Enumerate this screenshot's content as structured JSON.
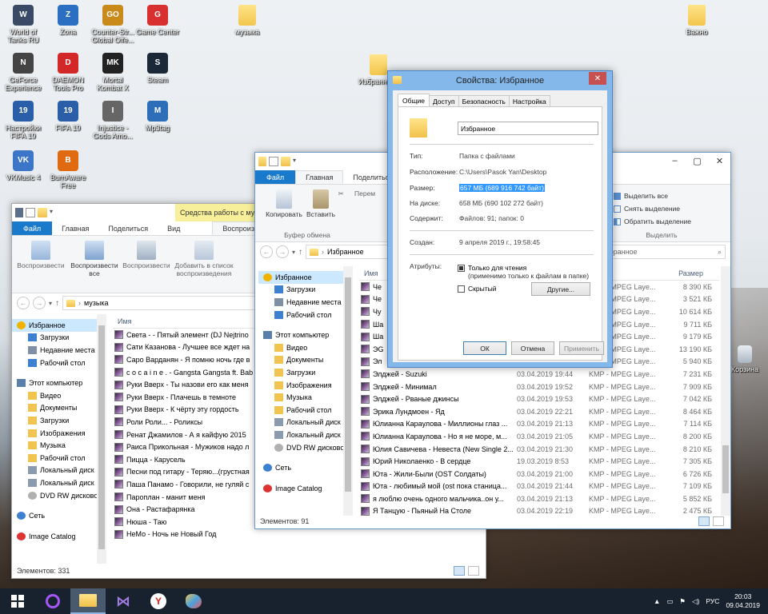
{
  "desktop": {
    "icons": [
      {
        "label": "World of\nTanks RU",
        "icon": "wot-icon",
        "color": "#3a4a66",
        "glyph": "W"
      },
      {
        "label": "Zona",
        "icon": "zona-icon",
        "color": "#2b6fc2",
        "glyph": "Z"
      },
      {
        "label": "Counter-Str...\nGlobal Offe...",
        "icon": "csgo-icon",
        "color": "#c98a1a",
        "glyph": "GO"
      },
      {
        "label": "Game Center",
        "icon": "gamecenter-icon",
        "color": "#d83030",
        "glyph": "G"
      },
      {
        "label": "GeForce\nExperience",
        "icon": "geforce-icon",
        "color": "#444",
        "glyph": "N"
      },
      {
        "label": "DAEMON\nTools Pro",
        "icon": "daemon-icon",
        "color": "#d32828",
        "glyph": "D"
      },
      {
        "label": "Mortal\nKombat X",
        "icon": "mortal-kombat-icon",
        "color": "#222",
        "glyph": "MK"
      },
      {
        "label": "Steam",
        "icon": "steam-icon",
        "color": "#1b2838",
        "glyph": "S"
      },
      {
        "label": "Настройки\nFIFA 19",
        "icon": "fifa-settings-icon",
        "color": "#2a5ea8",
        "glyph": "19"
      },
      {
        "label": "FIFA 19",
        "icon": "fifa-icon",
        "color": "#2a5ea8",
        "glyph": "19"
      },
      {
        "label": "Injustice -\nGods Amo...",
        "icon": "injustice-icon",
        "color": "#666",
        "glyph": "I"
      },
      {
        "label": "Mp3tag",
        "icon": "mp3tag-icon",
        "color": "#2c6fb8",
        "glyph": "M"
      },
      {
        "label": "VKMusic 4",
        "icon": "vkmusic-icon",
        "color": "#3b76c9",
        "glyph": "VK"
      },
      {
        "label": "BurnAware\nFree",
        "icon": "burnaware-icon",
        "color": "#e06a10",
        "glyph": "B"
      }
    ],
    "folders": [
      {
        "label": "музыка"
      },
      {
        "label": "Важно"
      },
      {
        "label": "Избранн"
      }
    ],
    "recycle_label": "Корзина"
  },
  "win1": {
    "qat_title": "Средства работы с музы",
    "tabs": [
      "Файл",
      "Главная",
      "Поделиться",
      "Вид"
    ],
    "context_tab": "Воспроизведение",
    "ribbon": [
      "Воспроизвести",
      "Воспроизвести все",
      "Воспроизвести",
      "Добавить в список воспроизведения"
    ],
    "path": "музыка",
    "col_name": "Имя",
    "nav": [
      {
        "label": "Избранное",
        "icon": "star-icon"
      },
      {
        "label": "Загрузки",
        "icon": "downloads-icon"
      },
      {
        "label": "Недавние места",
        "icon": "recent-icon"
      },
      {
        "label": "Рабочий стол",
        "icon": "desktop-icon"
      },
      {
        "label": "",
        "icon": ""
      },
      {
        "label": "Этот компьютер",
        "icon": "computer-icon"
      },
      {
        "label": "Видео",
        "icon": "folder-icon"
      },
      {
        "label": "Документы",
        "icon": "folder-icon"
      },
      {
        "label": "Загрузки",
        "icon": "folder-icon"
      },
      {
        "label": "Изображения",
        "icon": "folder-icon"
      },
      {
        "label": "Музыка",
        "icon": "folder-icon"
      },
      {
        "label": "Рабочий стол",
        "icon": "folder-icon"
      },
      {
        "label": "Локальный диск",
        "icon": "drive-icon"
      },
      {
        "label": "Локальный диск",
        "icon": "drive-icon"
      },
      {
        "label": "DVD RW дисково",
        "icon": "dvd-icon"
      },
      {
        "label": "",
        "icon": ""
      },
      {
        "label": "Сеть",
        "icon": "network-icon"
      },
      {
        "label": "",
        "icon": ""
      },
      {
        "label": "Image Catalog",
        "icon": "catalog-icon"
      }
    ],
    "files": [
      "Света - - Пятый элемент (DJ Nejtrino",
      "Сати Казанова - Лучшее все ждет на",
      "Саро Варданян - Я помню ночь где в",
      "c o c a i n e . - Gangsta Gangsta ft. Baby",
      "Руки Вверх - Ты назови его как меня",
      "Руки Вверх - Плачешь в темноте",
      "Руки Вверх - К чёрту эту гордость",
      "Роли Роли... - Роликсы",
      "Ренат Джамилов - А я кайфую 2015",
      "Раиса Прикольная - Мужиков надо л",
      "Пицца - Карусель",
      "Песни под гитару - Теряю...(грустная",
      "Паша Панамо - Говорили, не гуляй с",
      "Пароплан - манит меня",
      "Она - Растафарянка",
      "Нюша - Таю",
      "НеМо - Ночь не Новый Год"
    ],
    "status": "Элементов: 331"
  },
  "win2": {
    "tabs": [
      "Файл",
      "Главная",
      "Поделиться"
    ],
    "ribbon": [
      "Копировать",
      "Вставить",
      "Перем",
      "Буфер обмена"
    ],
    "right_ribbon": [
      "Выделить все",
      "Снять выделение",
      "Обратить выделение",
      "Выделить"
    ],
    "path": "Избранное",
    "search": "Поиск: Избранное",
    "col_name": "Имя",
    "col_size": "Размер",
    "nav": [
      {
        "label": "Избранное",
        "icon": "star-icon"
      },
      {
        "label": "Загрузки",
        "icon": "downloads-icon"
      },
      {
        "label": "Недавние места",
        "icon": "recent-icon"
      },
      {
        "label": "Рабочий стол",
        "icon": "desktop-icon"
      },
      {
        "label": "",
        "icon": ""
      },
      {
        "label": "Этот компьютер",
        "icon": "computer-icon"
      },
      {
        "label": "Видео",
        "icon": "folder-icon"
      },
      {
        "label": "Документы",
        "icon": "folder-icon"
      },
      {
        "label": "Загрузки",
        "icon": "folder-icon"
      },
      {
        "label": "Изображения",
        "icon": "folder-icon"
      },
      {
        "label": "Музыка",
        "icon": "folder-icon"
      },
      {
        "label": "Рабочий стол",
        "icon": "folder-icon"
      },
      {
        "label": "Локальный диск",
        "icon": "drive-icon"
      },
      {
        "label": "Локальный диск",
        "icon": "drive-icon"
      },
      {
        "label": "DVD RW дисково",
        "icon": "dvd-icon"
      },
      {
        "label": "",
        "icon": ""
      },
      {
        "label": "Сеть",
        "icon": "network-icon"
      },
      {
        "label": "",
        "icon": ""
      },
      {
        "label": "Image Catalog",
        "icon": "catalog-icon"
      }
    ],
    "files": [
      {
        "name": "Че",
        "date": "",
        "type": "KMP - MPEG Laye...",
        "size": "8 390 КБ"
      },
      {
        "name": "Че",
        "date": "",
        "type": "KMP - MPEG Laye...",
        "size": "3 521 КБ"
      },
      {
        "name": "Чу",
        "date": "",
        "type": "KMP - MPEG Laye...",
        "size": "10 614 КБ"
      },
      {
        "name": "Ша",
        "date": "",
        "type": "KMP - MPEG Laye...",
        "size": "9 711 КБ"
      },
      {
        "name": "Ша",
        "date": "",
        "type": "KMP - MPEG Laye...",
        "size": "9 179 КБ"
      },
      {
        "name": "ЭG",
        "date": "",
        "type": "KMP - MPEG Laye...",
        "size": "13 190 КБ"
      },
      {
        "name": "Эл",
        "date": "",
        "type": "KMP - MPEG Laye...",
        "size": "5 940 КБ"
      },
      {
        "name": "Элджей - Suzuki",
        "date": "03.04.2019 19:44",
        "type": "KMP - MPEG Laye...",
        "size": "7 231 КБ"
      },
      {
        "name": "Элджей - Минимал",
        "date": "03.04.2019 19:52",
        "type": "KMP - MPEG Laye...",
        "size": "7 909 КБ"
      },
      {
        "name": "Элджей - Рваные джинсы",
        "date": "03.04.2019 19:53",
        "type": "KMP - MPEG Laye...",
        "size": "7 042 КБ"
      },
      {
        "name": "Эрика Лундмоен - Яд",
        "date": "03.04.2019 22:21",
        "type": "KMP - MPEG Laye...",
        "size": "8 464 КБ"
      },
      {
        "name": "Юлианна Караулова - Миллионы глаз ...",
        "date": "03.04.2019 21:13",
        "type": "KMP - MPEG Laye...",
        "size": "7 114 КБ"
      },
      {
        "name": "Юлианна Караулова - Но я не море, м...",
        "date": "03.04.2019 21:05",
        "type": "KMP - MPEG Laye...",
        "size": "8 200 КБ"
      },
      {
        "name": "Юлия Савичева - Невеста (New Single 2...",
        "date": "03.04.2019 21:30",
        "type": "KMP - MPEG Laye...",
        "size": "8 210 КБ"
      },
      {
        "name": "Юрий Николаенко - В сердце",
        "date": "19.03.2019 8:53",
        "type": "KMP - MPEG Laye...",
        "size": "7 305 КБ"
      },
      {
        "name": "Юта - Жили-Были (OST Солдаты)",
        "date": "03.04.2019 21:00",
        "type": "KMP - MPEG Laye...",
        "size": "6 726 КБ"
      },
      {
        "name": "Юта - любимый мой (ost пока станица...",
        "date": "03.04.2019 21:44",
        "type": "KMP - MPEG Laye...",
        "size": "7 109 КБ"
      },
      {
        "name": "я люблю очень одного мальчика..он у...",
        "date": "03.04.2019 21:13",
        "type": "KMP - MPEG Laye...",
        "size": "5 852 КБ"
      },
      {
        "name": "Я Танцую - Пьяный На Столе",
        "date": "03.04.2019 22:19",
        "type": "KMP - MPEG Laye...",
        "size": "2 475 КБ"
      }
    ],
    "status": "Элементов: 91"
  },
  "dialog": {
    "title": "Свойства: Избранное",
    "tabs": [
      "Общие",
      "Доступ",
      "Безопасность",
      "Настройка"
    ],
    "name": "Избранное",
    "props": [
      {
        "label": "Тип:",
        "value": "Папка с файлами"
      },
      {
        "label": "Расположение:",
        "value": "C:\\Users\\Pasok Yan\\Desktop"
      },
      {
        "label": "Размер:",
        "value": "657 МБ (689 916 742 байт)"
      },
      {
        "label": "На диске:",
        "value": "658 МБ (690 102 272 байт)"
      },
      {
        "label": "Содержит:",
        "value": "Файлов: 91; папок: 0"
      },
      {
        "label": "Создан:",
        "value": "9 апреля 2019 г., 19:58:45"
      }
    ],
    "attrs_label": "Атрибуты:",
    "readonly": "Только для чтения",
    "readonly_note": "(применимо только к файлам в папке)",
    "hidden": "Скрытый",
    "other": "Другие...",
    "ok": "ОК",
    "cancel": "Отмена",
    "apply": "Применить"
  },
  "taskbar": {
    "lang": "РУС",
    "time": "20:03",
    "date": "09.04.2019"
  }
}
